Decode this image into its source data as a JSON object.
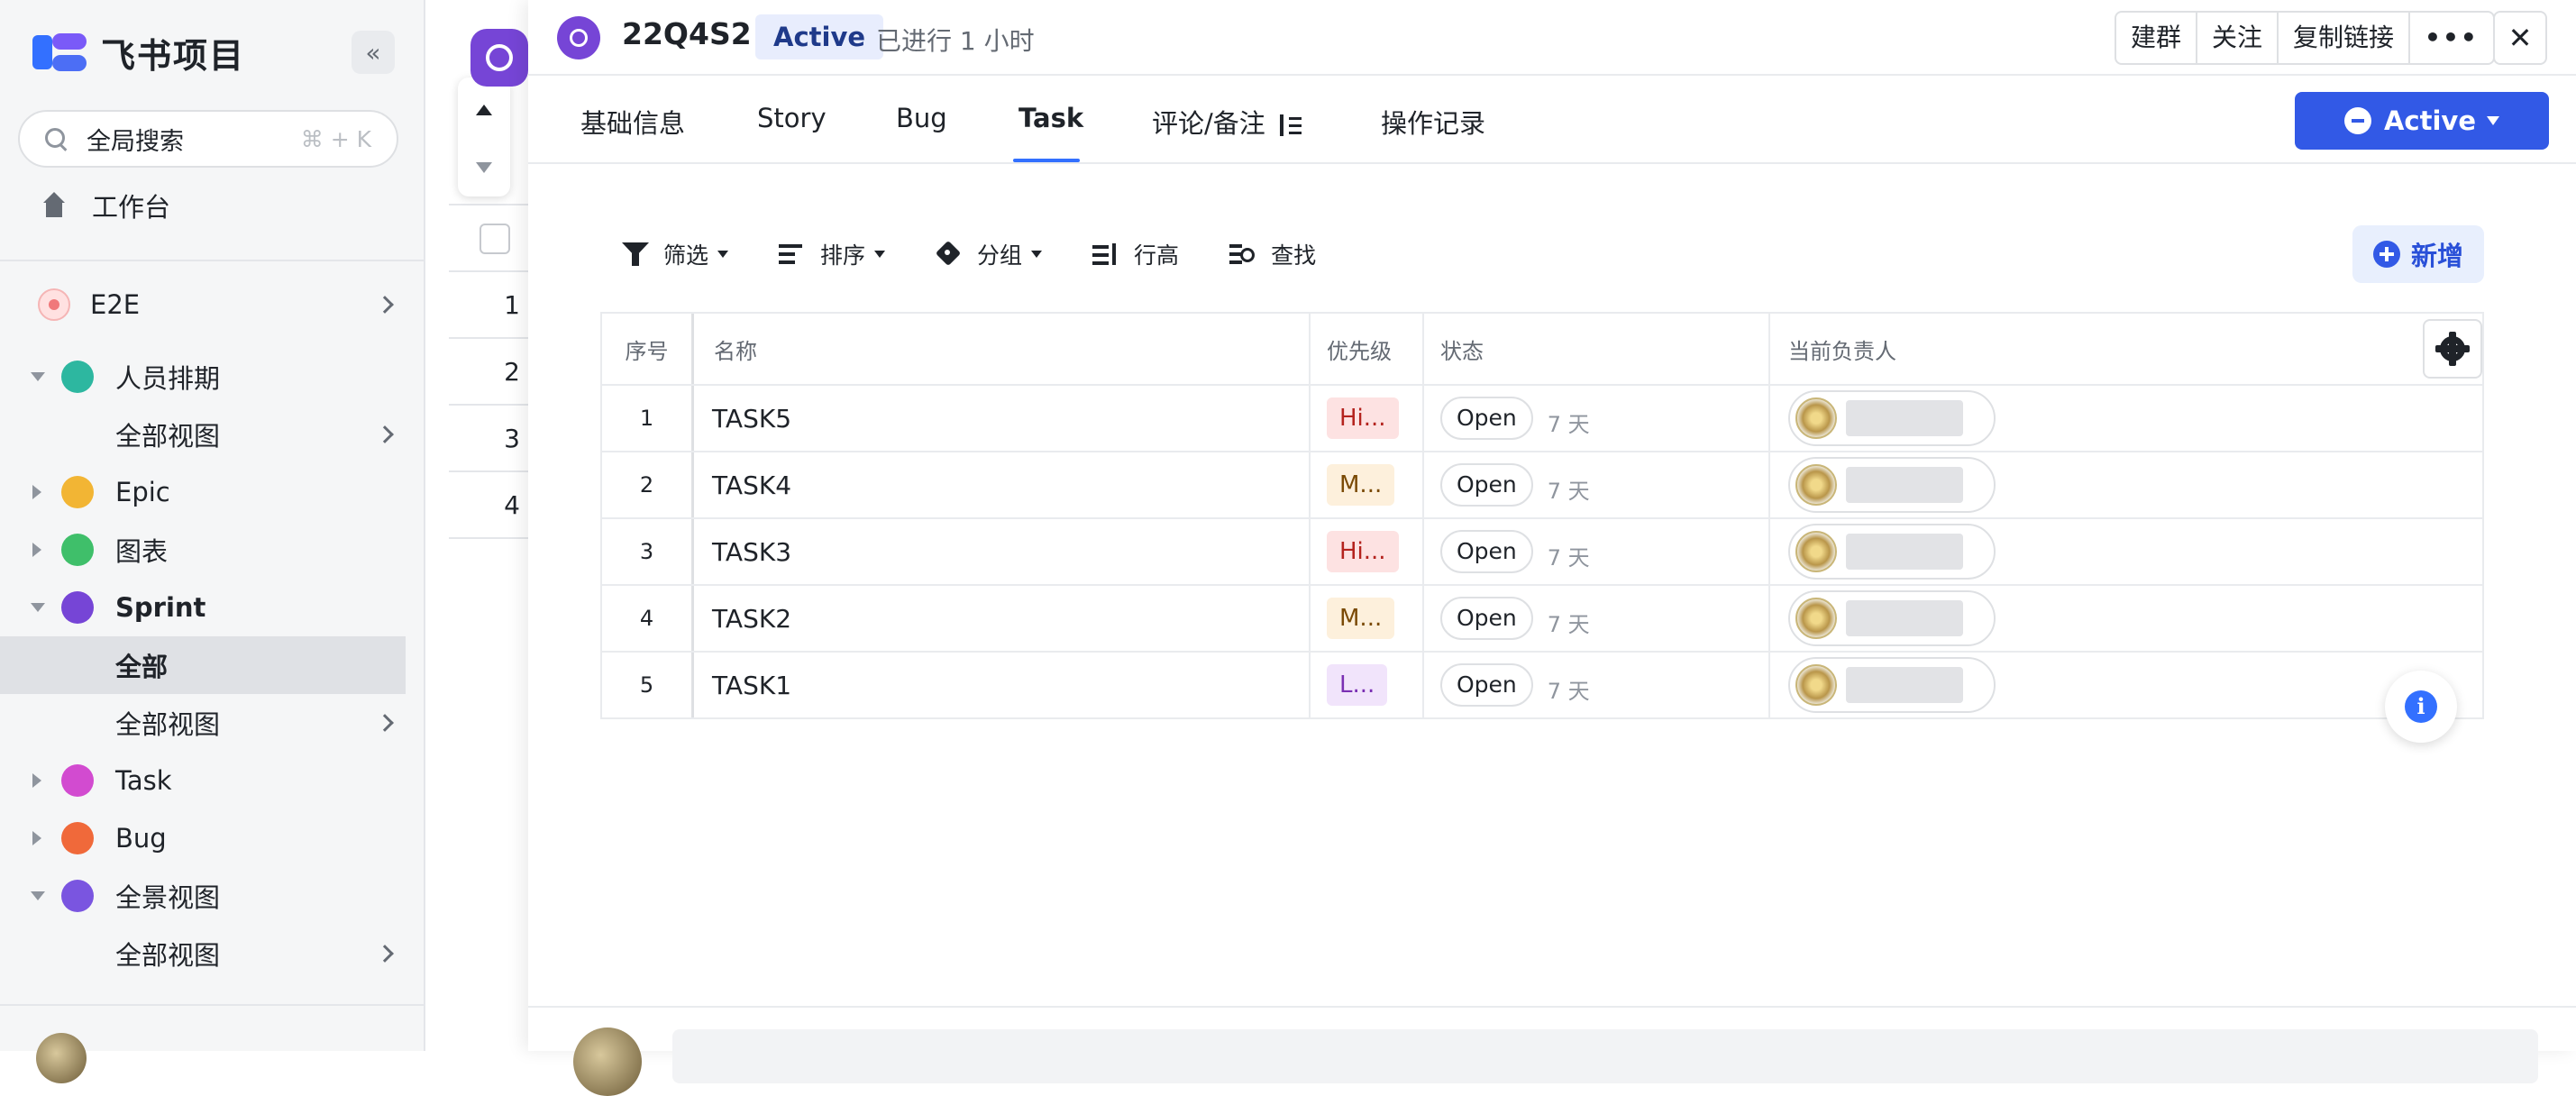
{
  "app": {
    "name": "飞书项目"
  },
  "sidebar": {
    "search_placeholder": "全局搜索",
    "search_shortcut": "⌘ + K",
    "workbench": "工作台",
    "space": "E2E",
    "items": [
      {
        "label": "人员排期",
        "icon": "table-icon",
        "color": "#2db7a0",
        "expanded": true
      },
      {
        "label": "全部视图",
        "sub": true
      },
      {
        "label": "Epic",
        "icon": "doc-icon",
        "color": "#f2b534",
        "expanded": false
      },
      {
        "label": "图表",
        "icon": "chart-icon",
        "color": "#3fbf6a",
        "expanded": false
      },
      {
        "label": "Sprint",
        "icon": "sprint-icon",
        "color": "#7645d6",
        "expanded": true
      },
      {
        "label": "全部",
        "sub": true,
        "selected": true
      },
      {
        "label": "全部视图",
        "sub": true
      },
      {
        "label": "Task",
        "icon": "doc-icon",
        "color": "#d24bd0",
        "expanded": false
      },
      {
        "label": "Bug",
        "icon": "doc-icon",
        "color": "#f0693a",
        "expanded": false
      },
      {
        "label": "全景视图",
        "icon": "panorama-icon",
        "color": "#7a55e0",
        "expanded": true
      },
      {
        "label": "全部视图",
        "sub": true
      }
    ]
  },
  "background_list": {
    "rows": [
      "1",
      "2",
      "3",
      "4"
    ]
  },
  "detail": {
    "title": "22Q4S2",
    "status_badge": "Active",
    "elapsed": "已进行 1 小时",
    "actions": [
      "建群",
      "关注",
      "复制链接",
      "•••"
    ],
    "close": "✕",
    "tabs": [
      "基础信息",
      "Story",
      "Bug",
      "Task",
      "评论/备注",
      "操作记录"
    ],
    "active_tab": "Task",
    "status_button": "Active",
    "toolbar": {
      "filter": "筛选",
      "sort": "排序",
      "group": "分组",
      "row_height": "行高",
      "find": "查找",
      "add": "新增"
    },
    "table": {
      "columns": [
        "序号",
        "名称",
        "优先级",
        "状态",
        "当前负责人"
      ],
      "rows": [
        {
          "no": "1",
          "name": "TASK5",
          "priority": "Hi...",
          "priority_level": "high",
          "status": "Open",
          "days": "7 天"
        },
        {
          "no": "2",
          "name": "TASK4",
          "priority": "M...",
          "priority_level": "mid",
          "status": "Open",
          "days": "7 天"
        },
        {
          "no": "3",
          "name": "TASK3",
          "priority": "Hi...",
          "priority_level": "high",
          "status": "Open",
          "days": "7 天"
        },
        {
          "no": "4",
          "name": "TASK2",
          "priority": "M...",
          "priority_level": "mid",
          "status": "Open",
          "days": "7 天"
        },
        {
          "no": "5",
          "name": "TASK1",
          "priority": "L...",
          "priority_level": "low",
          "status": "Open",
          "days": "7 天"
        }
      ]
    }
  },
  "colors": {
    "accent": "#3259e6",
    "sprint": "#7645d6"
  }
}
